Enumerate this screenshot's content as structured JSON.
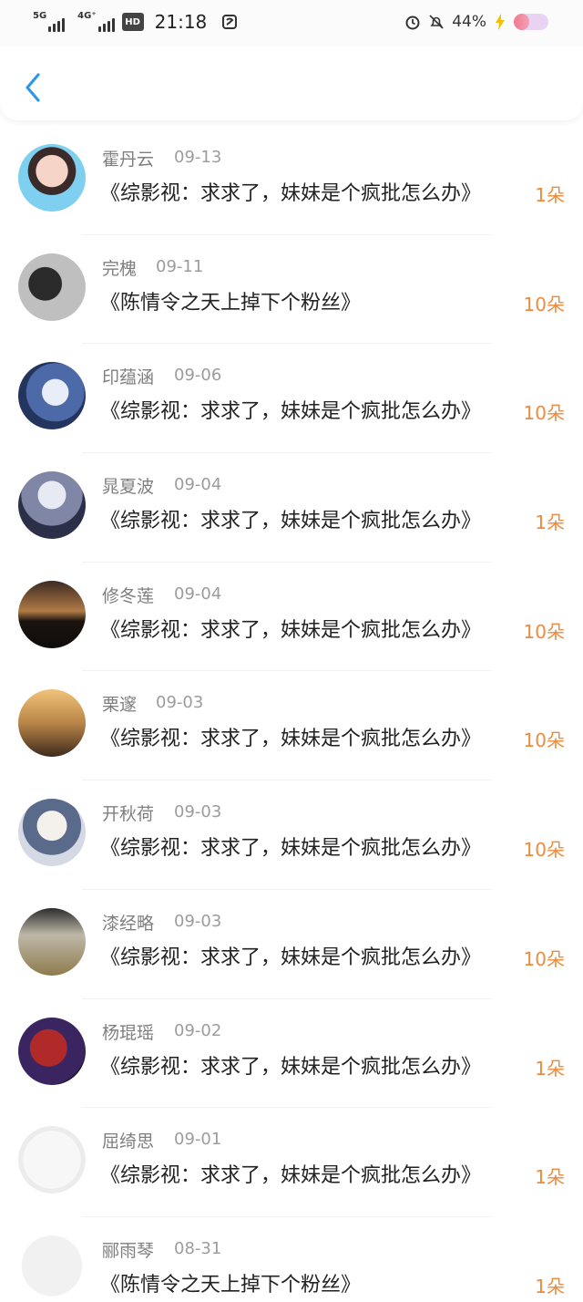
{
  "status_bar": {
    "sig1_label": "5G",
    "sig2_label": "4G⁺",
    "hd_label": "HD",
    "time": "21:18",
    "battery_percent": "44%",
    "battery_level": 0.44
  },
  "colors": {
    "accent_blue": "#2e98e8",
    "amount_orange": "#ef8a3c"
  },
  "nav": {
    "back_icon": "chevron-left-icon"
  },
  "records": [
    {
      "name": "霍丹云",
      "date": "09-13",
      "title": "《综影视：求求了，妹妹是个疯批怎么办》",
      "amount": "1朵"
    },
    {
      "name": "完槐",
      "date": "09-11",
      "title": "《陈情令之天上掉下个粉丝》",
      "amount": "10朵"
    },
    {
      "name": "印蕴涵",
      "date": "09-06",
      "title": "《综影视：求求了，妹妹是个疯批怎么办》",
      "amount": "10朵"
    },
    {
      "name": "晁夏波",
      "date": "09-04",
      "title": "《综影视：求求了，妹妹是个疯批怎么办》",
      "amount": "1朵"
    },
    {
      "name": "修冬莲",
      "date": "09-04",
      "title": "《综影视：求求了，妹妹是个疯批怎么办》",
      "amount": "10朵"
    },
    {
      "name": "栗邃",
      "date": "09-03",
      "title": "《综影视：求求了，妹妹是个疯批怎么办》",
      "amount": "10朵"
    },
    {
      "name": "开秋荷",
      "date": "09-03",
      "title": "《综影视：求求了，妹妹是个疯批怎么办》",
      "amount": "10朵"
    },
    {
      "name": "漆经略",
      "date": "09-03",
      "title": "《综影视：求求了，妹妹是个疯批怎么办》",
      "amount": "10朵"
    },
    {
      "name": "杨琨瑶",
      "date": "09-02",
      "title": "《综影视：求求了，妹妹是个疯批怎么办》",
      "amount": "1朵"
    },
    {
      "name": "屈绮思",
      "date": "09-01",
      "title": "《综影视：求求了，妹妹是个疯批怎么办》",
      "amount": "1朵"
    },
    {
      "name": "郦雨琴",
      "date": "08-31",
      "title": "《陈情令之天上掉下个粉丝》",
      "amount": "1朵"
    }
  ]
}
